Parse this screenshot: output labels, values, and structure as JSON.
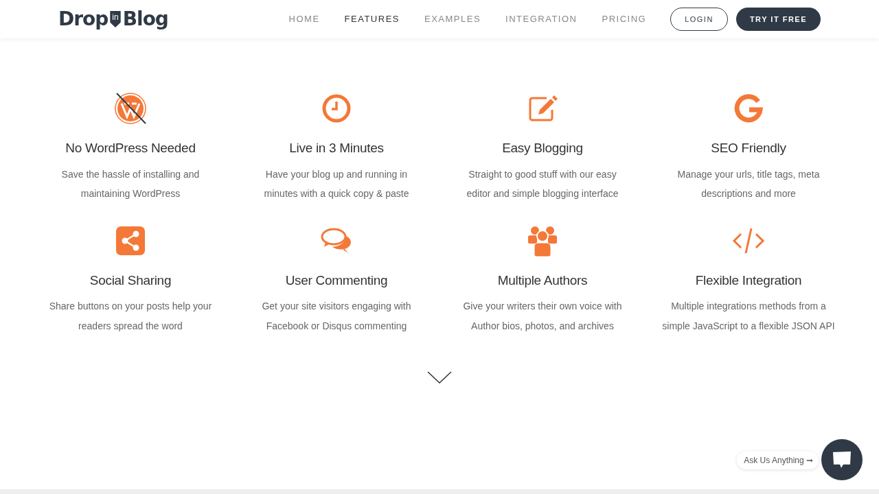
{
  "logo": {
    "part_1": "Drop",
    "badge": "in",
    "part_2": "Blog"
  },
  "nav": [
    {
      "label": "HOME",
      "selected": false
    },
    {
      "label": "FEATURES",
      "selected": true
    },
    {
      "label": "EXAMPLES",
      "selected": false
    },
    {
      "label": "INTEGRATION",
      "selected": false
    },
    {
      "label": "PRICING",
      "selected": false
    }
  ],
  "login_button": "LOGIN",
  "cta_button": "TRY IT FREE",
  "features": [
    {
      "title": "No WordPress Needed",
      "description": "Save the hassle of installing and maintaining WordPress"
    },
    {
      "title": "Live in 3 Minutes",
      "description": "Have your blog up and running in minutes with a quick copy & paste"
    },
    {
      "title": "Easy Blogging",
      "description": "Straight to good stuff with our easy editor and simple blogging interface"
    },
    {
      "title": "SEO Friendly",
      "description": "Manage your urls, title tags, meta descriptions and more"
    },
    {
      "title": "Social Sharing",
      "description": "Share buttons on your posts help your readers spread the word"
    },
    {
      "title": "User Commenting",
      "description": "Get your site visitors engaging with Facebook or Disqus commenting"
    },
    {
      "title": "Multiple Authors",
      "description": "Give your writers their own voice with Author bios, photos, and archives"
    },
    {
      "title": "Flexible Integration",
      "description": "Multiple integrations methods from a simple JavaScript to a flexible JSON API"
    }
  ],
  "chat": {
    "label": "Ask Us Anything ➞"
  }
}
